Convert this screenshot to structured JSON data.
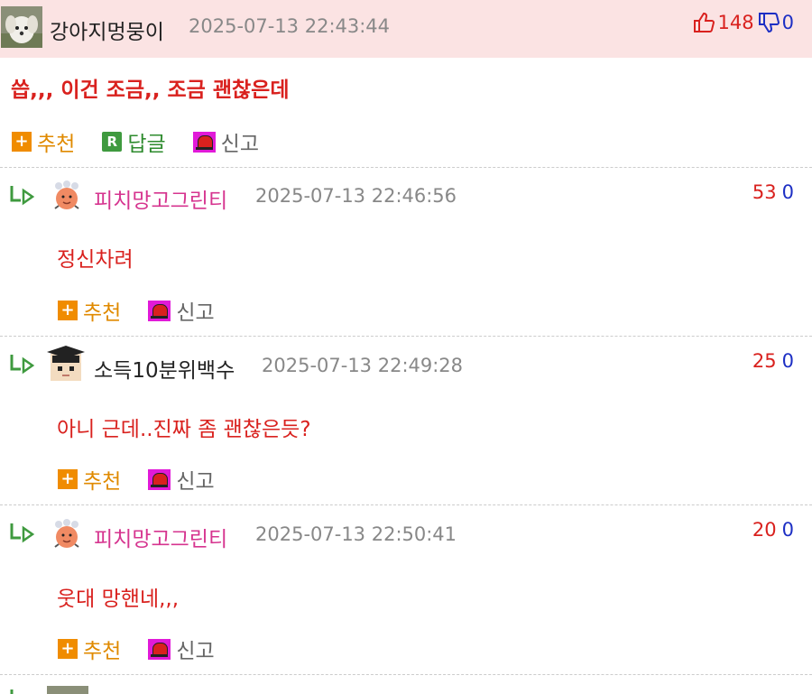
{
  "post": {
    "author": "강아지멍뭉이",
    "timestamp": "2025-07-13 22:43:44",
    "upvotes": "148",
    "downvotes": "0",
    "text": "씁,,, 이건 조금,, 조금 괜찮은데",
    "recommend_label": "추천",
    "reply_label": "답글",
    "report_label": "신고",
    "icons": {
      "avatar": "puppy-avatar",
      "up": "thumbs-up-icon",
      "down": "thumbs-down-icon"
    }
  },
  "replies": [
    {
      "author": "피치망고그린티",
      "timestamp": "2025-07-13 22:46:56",
      "upvotes": "53",
      "downvotes": "0",
      "text": "정신차려",
      "recommend_label": "추천",
      "report_label": "신고",
      "author_color": "#d6348f",
      "avatar": "peach-avatar"
    },
    {
      "author": "소득10분위백수",
      "timestamp": "2025-07-13 22:49:28",
      "upvotes": "25",
      "downvotes": "0",
      "text": "아니 근데..진짜 좀 괜찮은듯?",
      "recommend_label": "추천",
      "report_label": "신고",
      "author_color": "#222222",
      "avatar": "graduate-avatar"
    },
    {
      "author": "피치망고그린티",
      "timestamp": "2025-07-13 22:50:41",
      "upvotes": "20",
      "downvotes": "0",
      "text": "웃대 망핸네,,,",
      "recommend_label": "추천",
      "report_label": "신고",
      "author_color": "#d6348f",
      "avatar": "peach-avatar"
    }
  ],
  "colors": {
    "header_bg": "#fbe3e3",
    "red": "#d9211e",
    "blue": "#1d2fc4",
    "orange": "#e08a00",
    "green": "#2e8b2e",
    "pink": "#d6348f"
  }
}
